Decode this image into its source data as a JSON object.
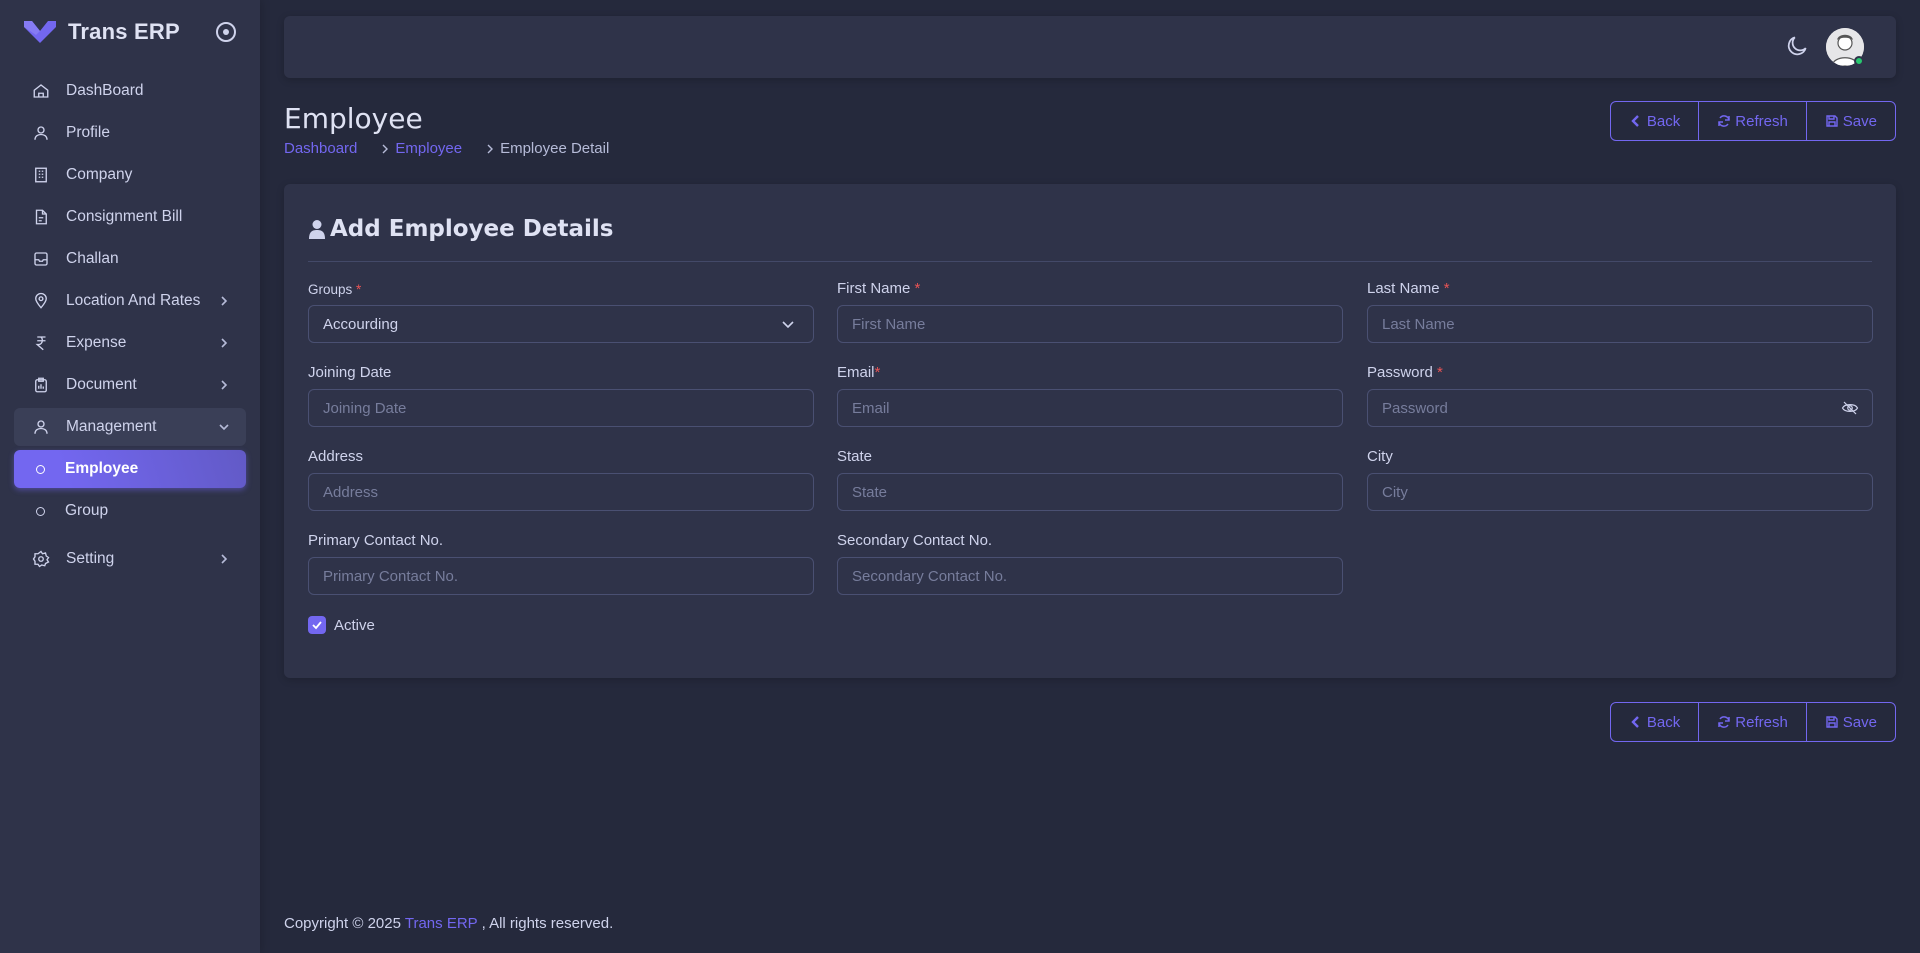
{
  "app": {
    "name": "Trans ERP",
    "accent_color": "#7367f0",
    "background_color": "#25293c",
    "panel_color": "#2f3349"
  },
  "sidebar": {
    "items": [
      {
        "label": "DashBoard",
        "icon": "home-icon"
      },
      {
        "label": "Profile",
        "icon": "user-icon"
      },
      {
        "label": "Company",
        "icon": "building-icon"
      },
      {
        "label": "Consignment Bill",
        "icon": "file-icon"
      },
      {
        "label": "Challan",
        "icon": "inbox-icon"
      },
      {
        "label": "Location And Rates",
        "icon": "map-pin-icon"
      },
      {
        "label": "Expense",
        "icon": "rupee-icon"
      },
      {
        "label": "Document",
        "icon": "document-icon"
      },
      {
        "label": "Management",
        "icon": "user-icon"
      },
      {
        "label": "Employee"
      },
      {
        "label": "Group"
      },
      {
        "label": "Setting",
        "icon": "gear-icon"
      }
    ]
  },
  "header": {
    "page_title": "Employee",
    "breadcrumb": [
      "Dashboard",
      "Employee",
      "Employee Detail"
    ]
  },
  "actions": {
    "back": "Back",
    "refresh": "Refresh",
    "save": "Save"
  },
  "form": {
    "title": "Add Employee Details",
    "groups": {
      "label": "Groups",
      "required": "*",
      "value": "Accourding"
    },
    "first_name": {
      "label": "First Name",
      "required": "*",
      "placeholder": "First Name"
    },
    "last_name": {
      "label": "Last Name",
      "required": "*",
      "placeholder": "Last Name"
    },
    "joining_date": {
      "label": "Joining Date",
      "placeholder": "Joining Date"
    },
    "email": {
      "label": "Email",
      "required": "*",
      "placeholder": "Email"
    },
    "password": {
      "label": "Password",
      "required": "*",
      "placeholder": "Password"
    },
    "address": {
      "label": "Address",
      "placeholder": "Address"
    },
    "state": {
      "label": "State",
      "placeholder": "State"
    },
    "city": {
      "label": "City",
      "placeholder": "City"
    },
    "primary_contact": {
      "label": "Primary Contact No.",
      "placeholder": "Primary Contact No."
    },
    "secondary_contact": {
      "label": "Secondary Contact No.",
      "placeholder": "Secondary Contact No."
    },
    "active": {
      "label": "Active",
      "checked": true
    }
  },
  "footer": {
    "prefix": "Copyright © 2025",
    "link": "Trans ERP",
    "suffix": ", All rights reserved."
  }
}
